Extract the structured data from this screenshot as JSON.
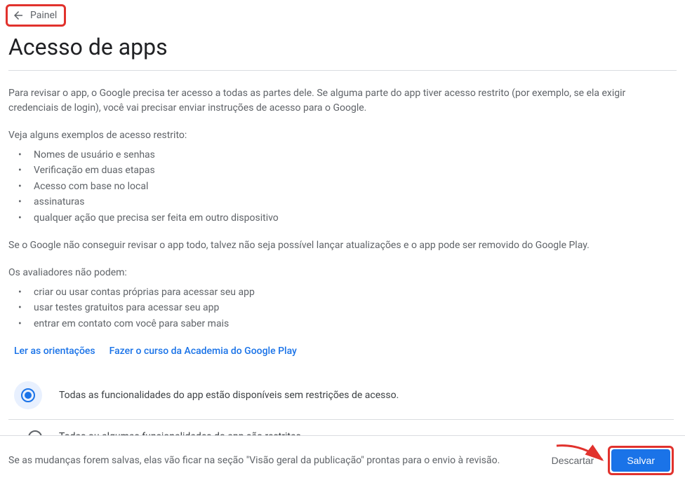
{
  "back": {
    "label": "Painel"
  },
  "page": {
    "title": "Acesso de apps"
  },
  "intro": {
    "p1": "Para revisar o app, o Google precisa ter acesso a todas as partes dele. Se alguma parte do app tiver acesso restrito (por exemplo, se ela exigir credenciais de login), você vai precisar enviar instruções de acesso para o Google.",
    "examples_header": "Veja alguns exemplos de acesso restrito:",
    "examples": [
      "Nomes de usuário e senhas",
      "Verificação em duas etapas",
      "Acesso com base no local",
      "assinaturas",
      "qualquer ação que precisa ser feita em outro dispositivo"
    ],
    "warning": "Se o Google não conseguir revisar o app todo, talvez não seja possível lançar atualizações e o app pode ser removido do Google Play.",
    "reviewers_header": "Os avaliadores não podem:",
    "reviewers": [
      "criar ou usar contas próprias para acessar seu app",
      "usar testes gratuitos para acessar seu app",
      "entrar em contato com você para saber mais"
    ]
  },
  "links": {
    "guidelines": "Ler as orientações",
    "academy": "Fazer o curso da Academia do Google Play"
  },
  "options": {
    "unrestricted": "Todas as funcionalidades do app estão disponíveis sem restrições de acesso.",
    "restricted": "Todas ou algumas funcionalidades do app são restritas."
  },
  "footer": {
    "notice": "Se as mudanças forem salvas, elas vão ficar na seção \"Visão geral da publicação\" prontas para o envio à revisão.",
    "discard": "Descartar",
    "save": "Salvar"
  }
}
